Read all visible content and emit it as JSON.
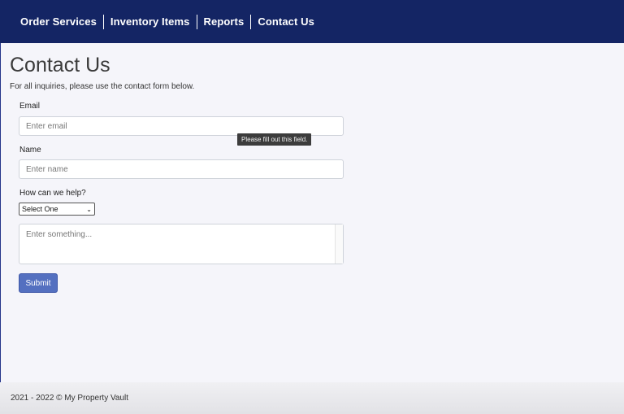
{
  "nav": {
    "items": [
      {
        "label": "Order Services"
      },
      {
        "label": "Inventory Items"
      },
      {
        "label": "Reports"
      },
      {
        "label": "Contact Us"
      }
    ]
  },
  "page": {
    "title": "Contact Us",
    "subtitle": "For all inquiries, please use the contact form below."
  },
  "form": {
    "email_label": "Email",
    "email_placeholder": "Enter email",
    "email_value": "",
    "validation_tooltip": "Please fill out this field.",
    "name_label": "Name",
    "name_placeholder": "Enter name",
    "name_value": "",
    "help_label": "How can we help?",
    "help_selected": "Select One",
    "message_placeholder": "Enter something...",
    "message_value": "",
    "submit_label": "Submit"
  },
  "footer": {
    "text": "2021 - 2022 © My Property Vault"
  },
  "colors": {
    "navbar_bg": "#142564",
    "submit_bg": "#5470c0",
    "page_bg": "#f5f5fa"
  },
  "icons": {
    "select_chevron": "chevron-down-icon"
  }
}
